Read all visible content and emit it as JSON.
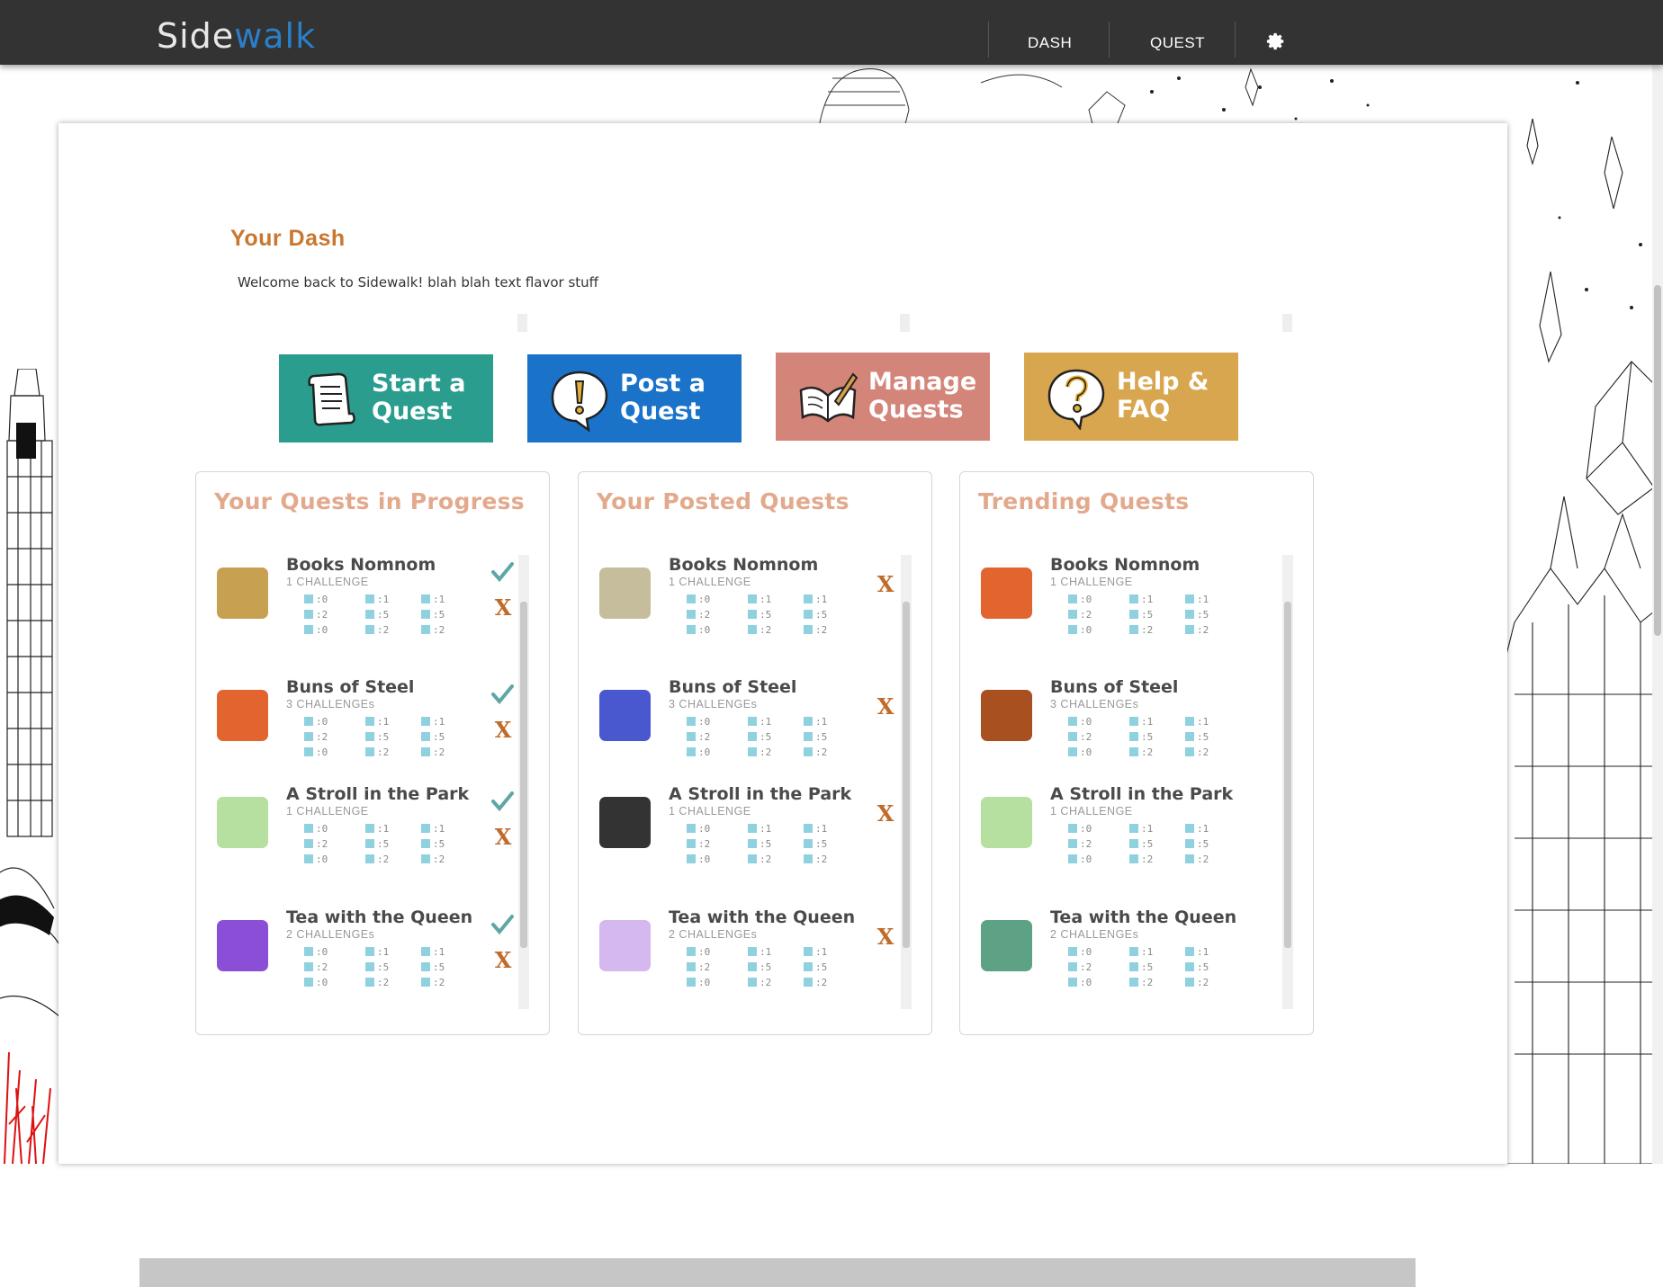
{
  "app": {
    "logo_part1": "Side",
    "logo_part2": "walk"
  },
  "nav": {
    "items": [
      "DASH",
      "QUEST"
    ],
    "settings_icon": "gear-icon"
  },
  "dash": {
    "title": "Your Dash",
    "subtitle": "Welcome back to Sidewalk! blah blah text flavor stuff"
  },
  "actions": [
    {
      "label": "Start a Quest",
      "color": "#2a9d8f",
      "icon": "scroll-icon"
    },
    {
      "label": "Post a Quest",
      "color": "#1a73c9",
      "icon": "exclamation-bubble-icon"
    },
    {
      "label": "Manage Quests",
      "color": "#d4857a",
      "icon": "open-book-icon"
    },
    {
      "label": "Help & FAQ",
      "color": "#d8a64e",
      "icon": "question-bubble-icon"
    }
  ],
  "cards": [
    {
      "title": "Your Quests in Progress",
      "show_check": true,
      "quests": [
        {
          "name": "Books Nomnom",
          "count": "1 CHALLENGE",
          "color": "#c8a052"
        },
        {
          "name": "Buns of Steel",
          "count": "3 CHALLENGEs",
          "color": "#e26530"
        },
        {
          "name": "A Stroll in the Park",
          "count": "1 CHALLENGE",
          "color": "#b5e0a0"
        },
        {
          "name": "Tea with the Queen",
          "count": "2 CHALLENGEs",
          "color": "#8a4fd6"
        }
      ]
    },
    {
      "title": "Your Posted Quests",
      "show_check": false,
      "quests": [
        {
          "name": "Books Nomnom",
          "count": "1 CHALLENGE",
          "color": "#c5bd9c"
        },
        {
          "name": "Buns of Steel",
          "count": "3 CHALLENGEs",
          "color": "#4a58cf"
        },
        {
          "name": "A Stroll in the Park",
          "count": "1 CHALLENGE",
          "color": "#333333"
        },
        {
          "name": "Tea with the Queen",
          "count": "2 CHALLENGEs",
          "color": "#d5b8ee"
        }
      ]
    },
    {
      "title": "Trending Quests",
      "show_check": false,
      "show_x": false,
      "quests": [
        {
          "name": "Books Nomnom",
          "count": "1 CHALLENGE",
          "color": "#e26530"
        },
        {
          "name": "Buns of Steel",
          "count": "3 CHALLENGEs",
          "color": "#a85020"
        },
        {
          "name": "A Stroll in the Park",
          "count": "1 CHALLENGE",
          "color": "#b5e0a0"
        },
        {
          "name": "Tea with the Queen",
          "count": "2 CHALLENGEs",
          "color": "#5ea285"
        }
      ]
    }
  ],
  "stats": [
    ":0",
    ":1",
    ":1",
    ":2",
    ":5",
    ":5",
    ":0",
    ":2",
    ":2"
  ],
  "colors": {
    "check": "#5fa6a6",
    "x": "#c06b2a",
    "title_accent": "#c8772e",
    "card_title": "#e3a98d"
  }
}
